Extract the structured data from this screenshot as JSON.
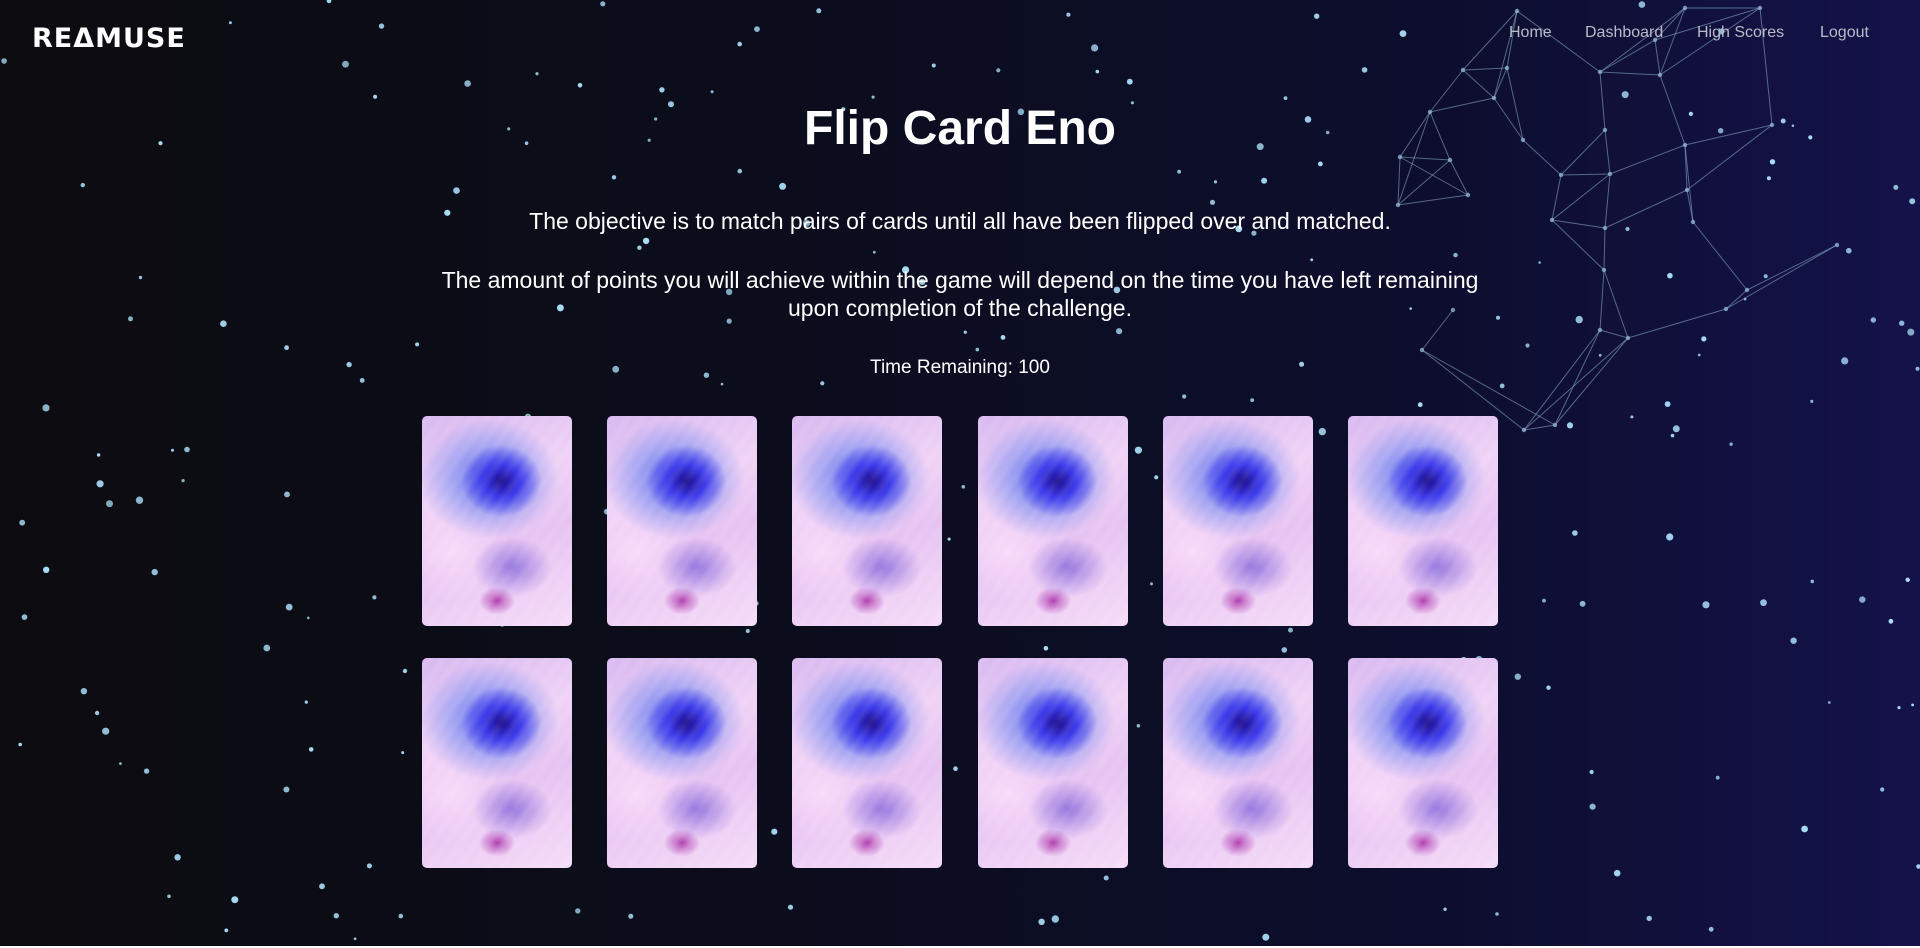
{
  "brand": {
    "logo_text": "REΔMUSE"
  },
  "nav": {
    "items": [
      {
        "label": "Home"
      },
      {
        "label": "Dashboard"
      },
      {
        "label": "High Scores"
      },
      {
        "label": "Logout"
      }
    ]
  },
  "game": {
    "title": "Flip Card Eno",
    "description_1": "The objective is to match pairs of cards until all have been flipped over and matched.",
    "description_2_line_1": "The amount of points you will achieve within the game will depend on the time you have left remaining",
    "description_2_line_2": "upon completion of the challenge.",
    "timer_label": "Time Remaining: ",
    "timer_value": "100",
    "card_rows": 2,
    "card_columns": 6,
    "card_state": "face-down"
  },
  "colors": {
    "background_dark": "#0c0c10",
    "background_navy": "#14124a",
    "star": "#a9dcf6",
    "network_line": "#8fb3cf",
    "nav_text": "#b8bcc8",
    "text": "#ffffff"
  }
}
